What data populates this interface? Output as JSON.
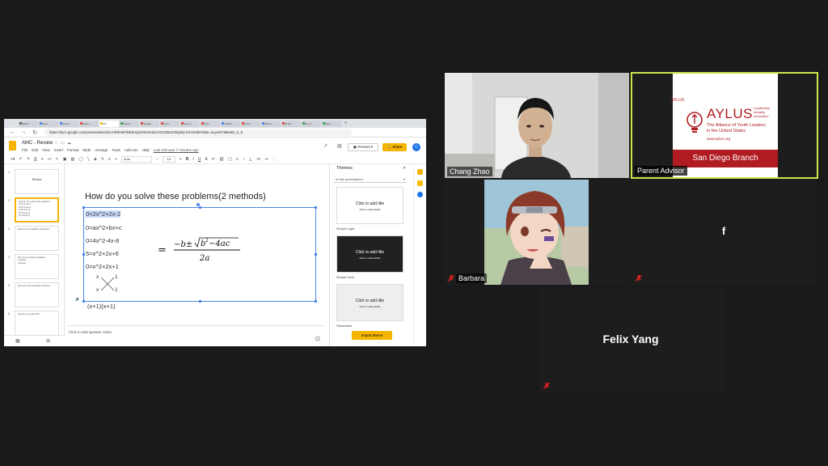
{
  "browser": {
    "tabs": [
      {
        "label": "DESN",
        "color": "#5f6368"
      },
      {
        "label": "quies",
        "color": "#4285f4"
      },
      {
        "label": "what is",
        "color": "#4285f4"
      },
      {
        "label": "make e",
        "color": "#ea4335"
      },
      {
        "label": "AM",
        "color": "#f4b400",
        "active": true
      },
      {
        "label": "Search",
        "color": "#34a853"
      },
      {
        "label": "quadrat",
        "color": "#ea4335"
      },
      {
        "label": "Unit 1",
        "color": "#ea4335"
      },
      {
        "label": "How to",
        "color": "#ea4335"
      },
      {
        "label": "Unit 1",
        "color": "#ea4335"
      },
      {
        "label": "matrics",
        "color": "#4285f4"
      },
      {
        "label": "Unit 8",
        "color": "#ea4335"
      },
      {
        "label": "drama",
        "color": "#4285f4"
      },
      {
        "label": "93 Mo",
        "color": "#ea4335"
      },
      {
        "label": "Run 3",
        "color": "#34a853"
      },
      {
        "label": "Electr",
        "color": "#34a853"
      }
    ],
    "new_tab": "+",
    "url": "https://docs.google.com/presentation/d/1oHRbhWFtl3bbUydUGEVedusc3GZXBUZ0Wy8Q-hGHi/edit#slide=id.gc847966a62_0_9"
  },
  "docs": {
    "title": "AMC - Review",
    "menu": [
      "File",
      "Edit",
      "View",
      "Insert",
      "Format",
      "Slide",
      "Arrange",
      "Tools",
      "Add-ons",
      "Help"
    ],
    "last_edit": "Last edit was 7 minutes ago",
    "present_label": "Present",
    "share_label": "Share",
    "avatar_letter": "C",
    "toolbar": {
      "font": "Arial",
      "size": "18",
      "bold": "B",
      "italic": "I",
      "underline": "U"
    }
  },
  "filmstrip": {
    "slides": [
      {
        "num": "1",
        "title": "Review",
        "lines": []
      },
      {
        "num": "2",
        "title": "",
        "lines": [
          "How do you solve these problems",
          "0=2x^2+2x-2",
          "0=ax^2+bx+c",
          "0=4x^2-4x-8",
          "5=x^2+2x+6",
          "0=x^2+2x+1"
        ],
        "selected": true
      },
      {
        "num": "3",
        "title": "",
        "lines": [
          "What are the quadratic equations?"
        ]
      },
      {
        "num": "4",
        "title": "",
        "lines": [
          "Why do you think a quadratic...",
          "example",
          "example"
        ]
      },
      {
        "num": "5",
        "title": "",
        "lines": [
          "Here are some quadratic functions..."
        ]
      },
      {
        "num": "6",
        "title": "",
        "lines": [
          "How do you graph this?"
        ]
      }
    ]
  },
  "slide": {
    "heading": "How do you solve these problems(2 methods)",
    "lines": [
      "0=2x^2+2x-2",
      "0=ax^2+bx+c",
      "0=4x^2-4x-8",
      "5=x^2+2x+6",
      "0=x^2+2x+1"
    ],
    "cross": {
      "tl": "x",
      "tr": "1",
      "bl": "x",
      "br": "1"
    },
    "factored": "(x+1)(x+1)",
    "formula_alt": "= (−b ± √(b² − 4ac)) / 2a"
  },
  "notes": {
    "placeholder": "Click to add speaker notes"
  },
  "themes": {
    "title": "Themes",
    "filter": "In this presentation",
    "cards": [
      {
        "name": "Simple Light",
        "title": "Click to add title",
        "subtitle": "Click to add subtitle",
        "bg": "#ffffff",
        "fg": "#222222"
      },
      {
        "name": "Simple Dark",
        "title": "Click to add title",
        "subtitle": "Click to add subtitle",
        "bg": "#212121",
        "fg": "#ffffff"
      },
      {
        "name": "Streamline",
        "title": "Click to add title",
        "subtitle": "Click to add subtitle",
        "bg": "#eeeeee",
        "fg": "#222222"
      }
    ],
    "import_label": "Import theme"
  },
  "participants": [
    {
      "name": "Chang Zhao",
      "kind": "video",
      "muted": false
    },
    {
      "name": "Parent Advisor",
      "kind": "video",
      "muted": false,
      "active_speaker": true,
      "banner": {
        "brand": "AYLUS",
        "tag1": "Leadership",
        "tag2": "Integrity",
        "tag3": "Innovation",
        "line1": "The Alliance of Youth Leaders",
        "line2": "in the United States",
        "site": "www.aylus.org",
        "branch": "San Diego Branch",
        "small_logo": "AYLUS"
      }
    },
    {
      "name": "Barbara",
      "kind": "video",
      "muted": true
    },
    {
      "name": "f",
      "kind": "avatar",
      "muted": true
    },
    {
      "name": "Felix Yang",
      "kind": "name",
      "muted": true
    }
  ],
  "colors": {
    "active_speaker_border": "#c8e64b",
    "aylus_red": "#b01c22",
    "muted_red": "#e02020"
  }
}
